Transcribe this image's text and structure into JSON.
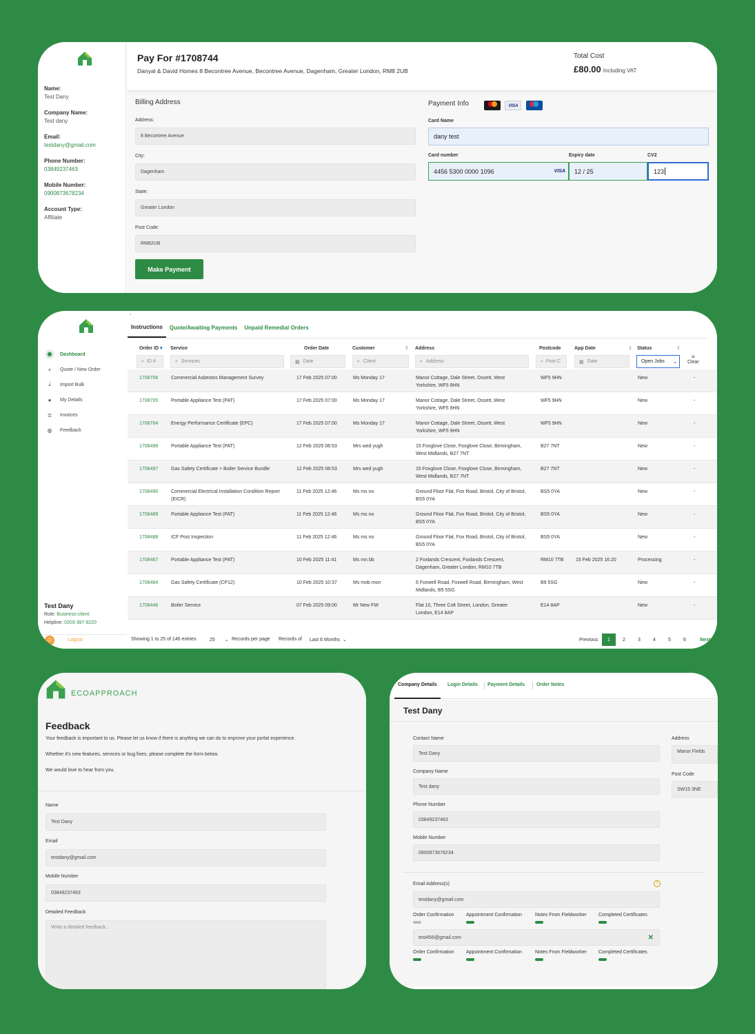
{
  "colors": {
    "brand": "#2e8b45",
    "background": "#2e8b45"
  },
  "card1": {
    "title": "Pay For #1708744",
    "address": "Danyal & David Homes 8 Becontree Avenue, Becontree Avenue, Dagenham, Greater London, RM8 2UB",
    "total_label": "Total Cost",
    "total_value": "£80.00",
    "total_vat": "Including VAT",
    "profile": {
      "name_label": "Name:",
      "name": "Test Dany",
      "company_label": "Company Name:",
      "company": "Test dany",
      "email_label": "Email:",
      "email": "testdany@gmail.com",
      "phone_label": "Phone Number:",
      "phone": "03849237463",
      "mobile_label": "Mobile Number:",
      "mobile": "0900873678234",
      "account_label": "Account Type:",
      "account": "Affiliate"
    },
    "billing": {
      "title": "Billing Address",
      "address_label": "Address:",
      "address": "8 Becontree Avenue",
      "city_label": "City:",
      "city": "Dagenham",
      "state_label": "State:",
      "state": "Greater London",
      "postcode_label": "Post Code:",
      "postcode": "RM82UB",
      "button": "Make Payment"
    },
    "payment": {
      "title": "Payment Info",
      "cards": [
        "MasterCard",
        "VISA",
        "Maestro"
      ],
      "card_name_label": "Card Name",
      "card_name": "dany test",
      "card_number_label": "Card number",
      "card_number": "4456 5300 0000 1096",
      "card_brand": "VISA",
      "expiry_label": "Expiry date",
      "expiry": "12 / 25",
      "cv2_label": "CV2",
      "cv2": "123"
    }
  },
  "card2": {
    "nav": [
      {
        "label": "Dashboard",
        "icon": "dashboard-icon",
        "active": true
      },
      {
        "label": "Quote / New Order",
        "icon": "plus-icon",
        "active": false
      },
      {
        "label": "Import Bulk",
        "icon": "download-icon",
        "active": false
      },
      {
        "label": "My Details",
        "icon": "user-icon",
        "active": false
      },
      {
        "label": "Invoices",
        "icon": "list-icon",
        "active": false
      },
      {
        "label": "Feedback",
        "icon": "chat-icon",
        "active": false
      }
    ],
    "user": {
      "name": "Test Dany",
      "role_label": "Role:",
      "role": "Business-client",
      "helpline_label": "Helpline:",
      "helpline": "0203 397 8220"
    },
    "logout": "Logout",
    "tabs": [
      "Instructions",
      "Quote/Awaiting Payments",
      "Unpaid Remedial Orders"
    ],
    "columns": [
      "Order ID",
      "Service",
      "Order Date",
      "Customer",
      "Address",
      "Postcode",
      "App Date",
      "Status"
    ],
    "filters": {
      "id": "ID #",
      "service": "Services",
      "date": "Date",
      "client": "Client",
      "address": "Address",
      "postcode": "Post C",
      "app_date": "Date",
      "status": "Open Jobs",
      "clear": "Clear"
    },
    "rows": [
      {
        "id": "1708706",
        "service": "Commercial Asbestos Management Survey",
        "date": "17 Feb 2025 07:00",
        "customer": "Ms Monday 17",
        "address": "Manor Cottage, Dale Street, Ossett, West Yorkshire, WF5 9HN",
        "postcode": "WF5 9HN",
        "app_date": "",
        "status": "New",
        "dash": "-"
      },
      {
        "id": "1708705",
        "service": "Portable Appliance Test (PAT)",
        "date": "17 Feb 2025 07:00",
        "customer": "Ms Monday 17",
        "address": "Manor Cottage, Dale Street, Ossett, West Yorkshire, WF5 9HN",
        "postcode": "WF5 9HN",
        "app_date": "",
        "status": "New",
        "dash": "-"
      },
      {
        "id": "1708704",
        "service": "Energy Performance Certificate (EPC)",
        "date": "17 Feb 2025 07:00",
        "customer": "Ms Monday 17",
        "address": "Manor Cottage, Dale Street, Ossett, West Yorkshire, WF5 9HN",
        "postcode": "WF5 9HN",
        "app_date": "",
        "status": "New",
        "dash": "-"
      },
      {
        "id": "1708498",
        "service": "Portable Appliance Test (PAT)",
        "date": "12 Feb 2025 08:53",
        "customer": "Mrs wed yugh",
        "address": "15 Foxglove Close, Foxglove Close, Birmingham, West Midlands, B27 7NT",
        "postcode": "B27 7NT",
        "app_date": "",
        "status": "New",
        "dash": "-"
      },
      {
        "id": "1708497",
        "service": "Gas Safety Certificate + Boiler Service Bundle",
        "date": "12 Feb 2025 08:53",
        "customer": "Mrs wed yugh",
        "address": "15 Foxglove Close, Foxglove Close, Birmingham, West Midlands, B27 7NT",
        "postcode": "B27 7NT",
        "app_date": "",
        "status": "New",
        "dash": "-"
      },
      {
        "id": "1708490",
        "service": "Commercial Electrical Installation Condition Report (EICR)",
        "date": "11 Feb 2025 12:46",
        "customer": "Ms ms no",
        "address": "Ground Floor Flat, Fox Road, Bristol, City of Bristol, BS5 0YA",
        "postcode": "BS5 0YA",
        "app_date": "",
        "status": "New",
        "dash": "-"
      },
      {
        "id": "1708489",
        "service": "Portable Appliance Test (PAT)",
        "date": "11 Feb 2025 12:46",
        "customer": "Ms ms no",
        "address": "Ground Floor Flat, Fox Road, Bristol, City of Bristol, BS5 0YA",
        "postcode": "BS5 0YA",
        "app_date": "",
        "status": "New",
        "dash": "-"
      },
      {
        "id": "1708488",
        "service": "ICF Post Inspection",
        "date": "11 Feb 2025 12:46",
        "customer": "Ms ms no",
        "address": "Ground Floor Flat, Fox Road, Bristol, City of Bristol, BS5 0YA",
        "postcode": "BS5 0YA",
        "app_date": "",
        "status": "New",
        "dash": "-"
      },
      {
        "id": "1708467",
        "service": "Portable Appliance Test (PAT)",
        "date": "10 Feb 2025 11:41",
        "customer": "Ms mn bb",
        "address": "2 Foxlands Crescent, Foxlands Crescent, Dagenham, Greater London, RM10 7TB",
        "postcode": "RM10 7TB",
        "app_date": "15 Feb 2025 16:20",
        "status": "Processing",
        "dash": "-"
      },
      {
        "id": "1708464",
        "service": "Gas Safety Certificate (CP12)",
        "date": "10 Feb 2025 10:37",
        "customer": "Ms mob mon",
        "address": "6 Foxwell Road, Foxwell Road, Birmingham, West Midlands, B9 5SG",
        "postcode": "B9 5SG",
        "app_date": "",
        "status": "New",
        "dash": "-"
      },
      {
        "id": "1708446",
        "service": "Boiler Service",
        "date": "07 Feb 2025 09:00",
        "customer": "Mr New FW",
        "address": "Flat 10, Three Colt Street, London, Greater London, E14 8AP",
        "postcode": "E14 8AP",
        "app_date": "",
        "status": "New",
        "dash": "-"
      }
    ],
    "pager": {
      "showing": "Showing 1 to 25 of 146 entries",
      "per_page": "25",
      "per_page_label": "Records per page",
      "records_of_label": "Records of",
      "records_of": "Last 6 Months",
      "previous": "Previous",
      "pages": [
        "1",
        "2",
        "3",
        "4",
        "5",
        "6"
      ],
      "next": "Next"
    }
  },
  "card3": {
    "brand": "ECOAPPROACH",
    "title": "Feedback",
    "p1": "Your feedback is important to us. Please let us know if there is anything we can do to improve your portal experience.",
    "p2": "Whether it's new features, services or bug fixes, please complete the form below.",
    "p3": "We would love to hear from you.",
    "name_label": "Name",
    "name": "Test Dany",
    "email_label": "Email",
    "email": "testdany@gmail.com",
    "mobile_label": "Mobile Number",
    "mobile": "03849237463",
    "feedback_label": "Detailed Feedback",
    "feedback_placeholder": "Write a detailed feedback..."
  },
  "card4": {
    "tabs": [
      "Company Details",
      "Login Details",
      "Payment Details",
      "Order Notes"
    ],
    "title": "Test Dany",
    "contact_label": "Contact Name",
    "contact": "Test Dany",
    "company_label": "Company Name",
    "company": "Test dany",
    "phone_label": "Phone Number",
    "phone": "03849237463",
    "mobile_label": "Mobile Number",
    "mobile": "0900873678234",
    "address_label": "Address",
    "address": "Manor Fields",
    "postcode_label": "Post Code",
    "postcode": "SW15 3NE",
    "emails_label": "Email Address(s)",
    "email1": "testdany@gmail.com",
    "email2": "test456@gmail.com",
    "toggles": [
      "Order Confirmation",
      "Appointment Confirmation",
      "Notes From Fieldworker",
      "Completed Certificates"
    ]
  }
}
